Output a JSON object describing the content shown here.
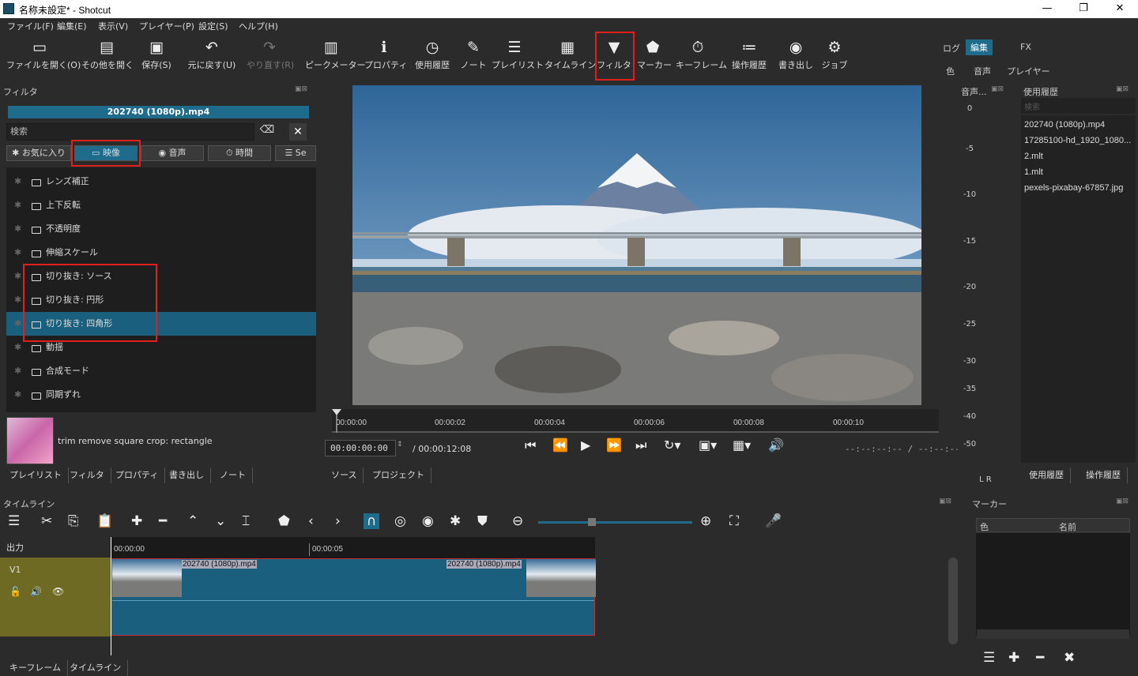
{
  "window": {
    "title": "名称未設定* - Shotcut",
    "min": "—",
    "max": "❐",
    "close": "✕"
  },
  "menu": [
    "ファイル(F)",
    "編集(E)",
    "表示(V)",
    "プレイヤー(P)",
    "設定(S)",
    "ヘルプ(H)"
  ],
  "toolbar": {
    "open": "ファイルを開く(O)",
    "open_other": "その他を開く",
    "save": "保存(S)",
    "undo": "元に戻す(U)",
    "redo": "やり直す(R)",
    "peak": "ピークメーター",
    "properties": "プロパティ",
    "recent": "使用履歴",
    "notes": "ノート",
    "playlist": "プレイリスト",
    "timeline": "タイムライン",
    "filters": "フィルタ",
    "markers": "マーカー",
    "keyframes": "キーフレーム",
    "history": "操作履歴",
    "export": "書き出し",
    "jobs": "ジョブ"
  },
  "layout_tabs": {
    "log": "ログ",
    "edit": "編集",
    "fx": "FX",
    "color": "色",
    "audio": "音声",
    "player": "プレイヤー"
  },
  "filter_panel": {
    "title": "フィルタ",
    "file": "202740 (1080p).mp4",
    "search_placeholder": "検索",
    "categories": {
      "fav": "お気に入り",
      "video": "映像",
      "audio": "音声",
      "time": "時間",
      "sets": "Se"
    },
    "items": [
      "レンズ補正",
      "上下反転",
      "不透明度",
      "伸縮スケール",
      "切り抜き: ソース",
      "切り抜き: 円形",
      "切り抜き: 四角形",
      "動揺",
      "合成モード",
      "同期ずれ"
    ],
    "description": "trim remove square crop: rectangle"
  },
  "left_tabs": [
    "プレイリスト",
    "フィルタ",
    "プロパティ",
    "書き出し",
    "ノート"
  ],
  "player": {
    "ruler": [
      "00:00:00",
      "00:00:02",
      "00:00:04",
      "00:00:06",
      "00:00:08",
      "00:00:10"
    ],
    "timecode": "00:00:00:00",
    "duration": "/ 00:00:12:08",
    "inout": "--:--:--:-- / --:--:--:--",
    "tabs": {
      "source": "ソース",
      "project": "プロジェクト"
    }
  },
  "audio_meter": {
    "title": "音声...",
    "labels": [
      "0",
      "-5",
      "-10",
      "-15",
      "-20",
      "-25",
      "-30",
      "-35",
      "-40",
      "-50"
    ],
    "lr": "L R"
  },
  "recent_panel": {
    "title": "使用履歴",
    "search": "検索",
    "items": [
      "202740 (1080p).mp4",
      "17285100-hd_1920_1080...",
      "2.mlt",
      "1.mlt",
      "pexels-pixabay-67857.jpg"
    ],
    "tabs": {
      "recent": "使用履歴",
      "history": "操作履歴"
    }
  },
  "timeline": {
    "title": "タイムライン",
    "output": "出力",
    "track": "V1",
    "times": [
      "00:00:00",
      "00:00:05"
    ],
    "clip1": "202740 (1080p).mp4",
    "clip2": "202740 (1080p).mp4"
  },
  "bottom_tabs": {
    "keyframes": "キーフレーム",
    "timeline": "タイムライン"
  },
  "markers": {
    "title": "マーカー",
    "col_color": "色",
    "col_name": "名前"
  }
}
